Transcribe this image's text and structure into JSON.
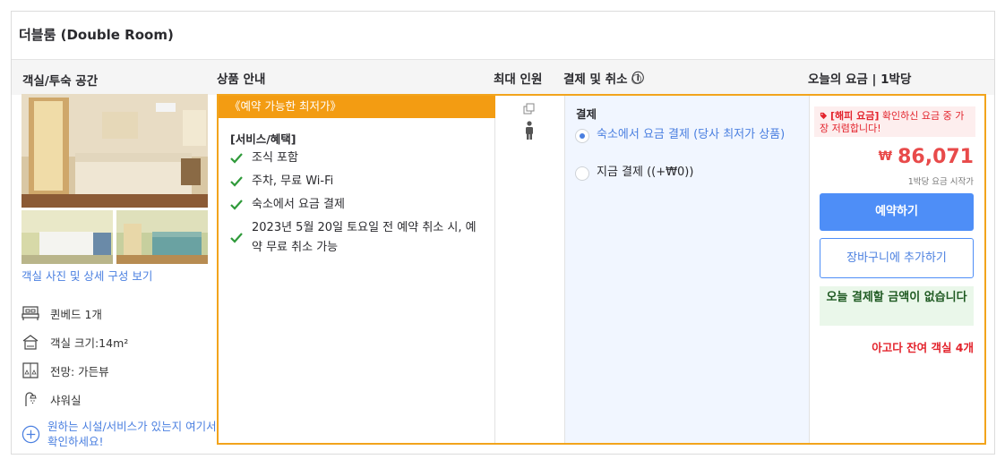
{
  "room": {
    "title": "더블룸 (Double Room)"
  },
  "headers": {
    "room_space": "객실/투숙 공간",
    "product_info": "상품 안내",
    "max_guests": "최대 인원",
    "payment_cancel": "결제 및 취소",
    "payment_cancel_info_icon": "ⓘ",
    "today_rate": "오늘의 요금 | 1박당"
  },
  "room_panel": {
    "photo_link": "객실 사진 및 상세 구성 보기",
    "features": [
      {
        "icon": "bed-icon",
        "label": "퀸베드 1개"
      },
      {
        "icon": "room-size-icon",
        "label": "객실 크기:14m²"
      },
      {
        "icon": "view-icon",
        "label": "전망: 가든뷰"
      },
      {
        "icon": "shower-icon",
        "label": "샤워실"
      }
    ],
    "ask_facility": "원하는 시설/서비스가 있는지 여기서 확인하세요!"
  },
  "offer": {
    "banner": "《예약 가능한 최저가》",
    "services_title": "[서비스/혜택]",
    "services": [
      "조식 포함",
      "주차, 무료 Wi-Fi",
      "숙소에서 요금 결제",
      "2023년 5월 20일 토요일 전 예약 취소 시, 예약 무료 취소 가능"
    ],
    "payment_title": "결제",
    "payment_options": [
      {
        "label": "숙소에서 요금 결제 (당사 최저가 상품)",
        "selected": true
      },
      {
        "label": "지금 결제 ((+₩0))",
        "selected": false
      }
    ],
    "promo_tag": "[해피 요금]",
    "promo_text": "확인하신 요금 중 가장 저렴합니다!",
    "currency": "₩",
    "price": "86,071",
    "price_note": "1박당 요금 시작가",
    "book_button": "예약하기",
    "cart_button": "장바구니에 추가하기",
    "no_payment_today": "오늘 결제할 금액이 없습니다",
    "rooms_left": "아고다 잔여 객실 4개"
  },
  "colors": {
    "accent": "#f39c12",
    "primary": "#4e8ef7",
    "price": "#e84a4a",
    "link": "#4a7fe0"
  }
}
